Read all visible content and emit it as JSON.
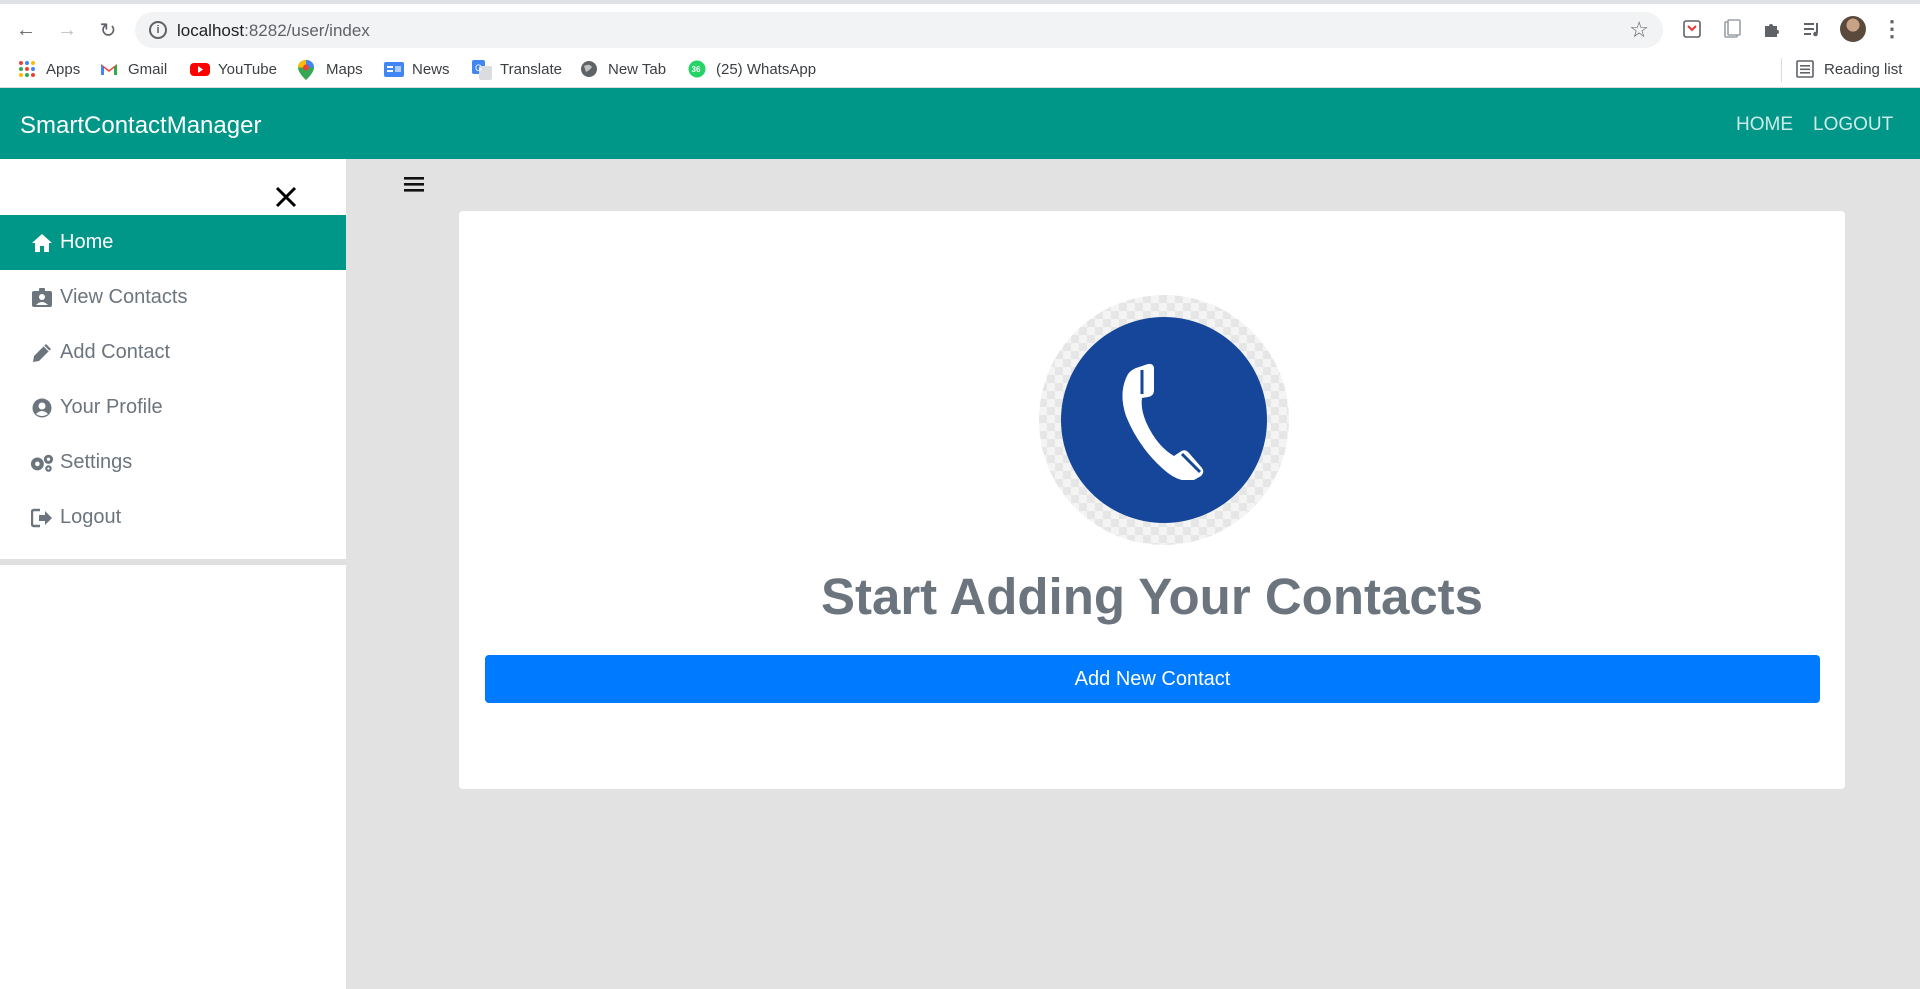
{
  "browser": {
    "url_host": "localhost",
    "url_rest": ":8282/user/index",
    "bookmarks": [
      {
        "label": "Apps",
        "icon": "apps-grid-icon"
      },
      {
        "label": "Gmail",
        "icon": "gmail-icon"
      },
      {
        "label": "YouTube",
        "icon": "youtube-icon"
      },
      {
        "label": "Maps",
        "icon": "maps-icon"
      },
      {
        "label": "News",
        "icon": "news-icon"
      },
      {
        "label": "Translate",
        "icon": "translate-icon"
      },
      {
        "label": "New Tab",
        "icon": "globe-icon"
      },
      {
        "label": "(25) WhatsApp",
        "icon": "whatsapp-icon"
      }
    ],
    "reading_list": "Reading list",
    "whatsapp_badge": "36"
  },
  "navbar": {
    "brand": "SmartContactManager",
    "links": [
      "HOME",
      "LOGOUT"
    ],
    "color": "#009688"
  },
  "sidebar": {
    "close_icon": "close-icon",
    "items": [
      {
        "label": "Home",
        "icon": "home-icon",
        "active": true
      },
      {
        "label": "View Contacts",
        "icon": "id-badge-icon"
      },
      {
        "label": "Add Contact",
        "icon": "pencil-icon"
      },
      {
        "label": "Your Profile",
        "icon": "user-circle-icon"
      },
      {
        "label": "Settings",
        "icon": "cogs-icon"
      },
      {
        "label": "Logout",
        "icon": "sign-out-icon"
      }
    ]
  },
  "main": {
    "menu_icon": "hamburger-icon",
    "title": "Start Adding Your Contacts",
    "button": "Add New Contact",
    "button_color": "#007bff",
    "illustration": "phone-icon"
  }
}
